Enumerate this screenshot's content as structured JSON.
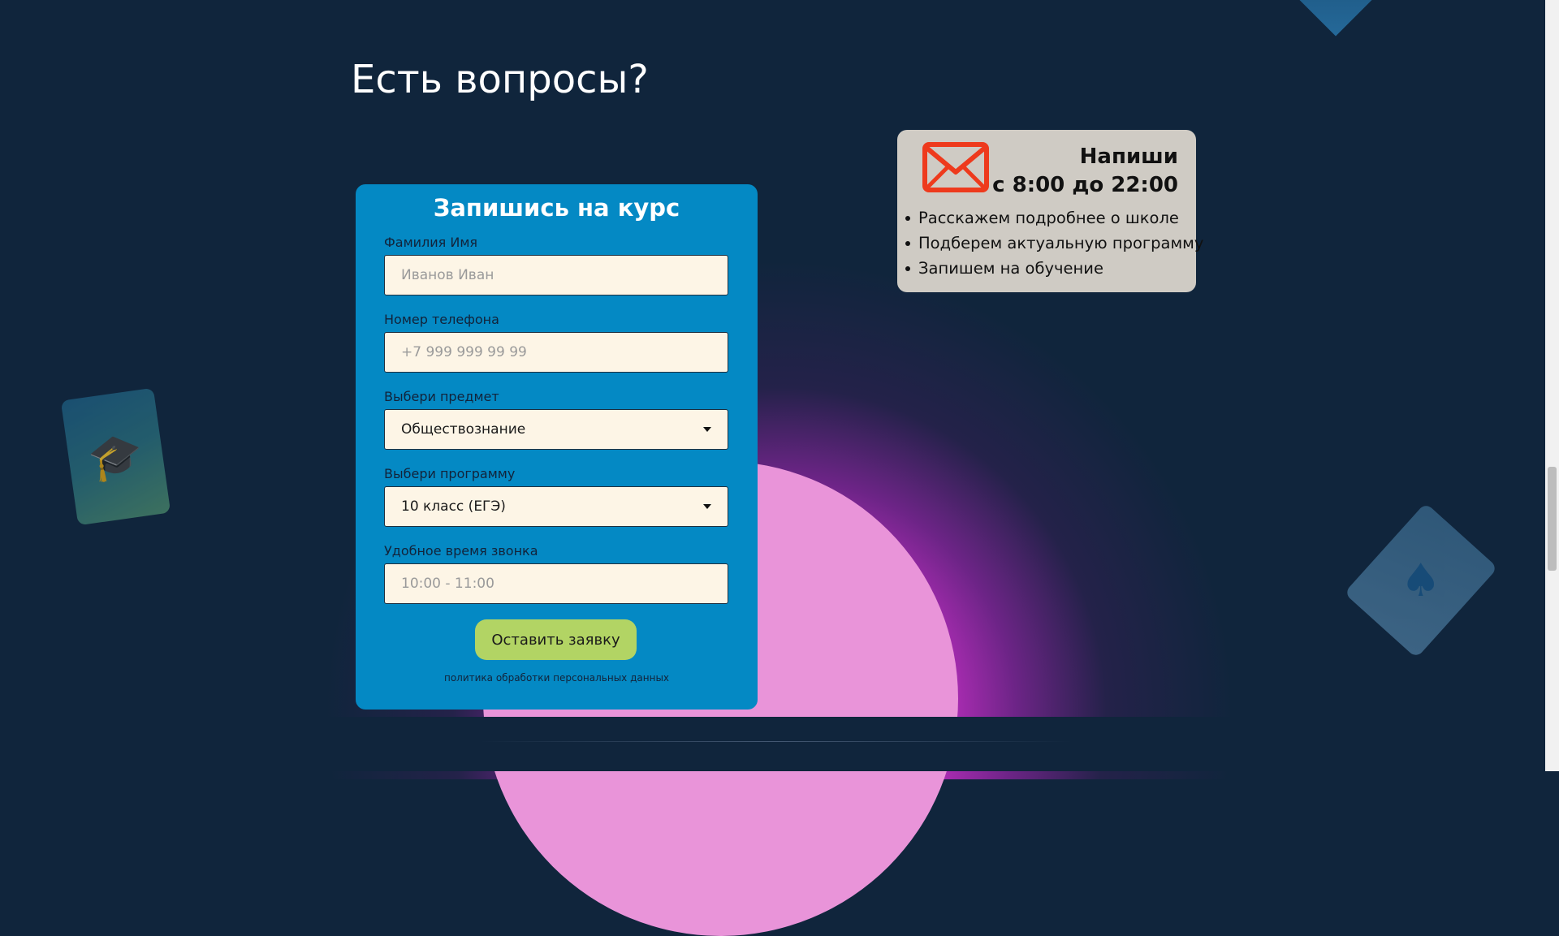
{
  "section": {
    "title": "Есть вопросы?"
  },
  "contact": {
    "heading_line1": "Напиши",
    "heading_line2": "с 8:00 до 22:00",
    "items": [
      "Расскажем подробнее о школе",
      "Подберем актуальную программу",
      "Запишем на обучение"
    ],
    "icon": "mail-icon",
    "icon_color": "#ee3a1d"
  },
  "form": {
    "title": "Запишись на курс",
    "name_label": "Фамилия Имя",
    "name_placeholder": "Иванов Иван",
    "phone_label": "Номер телефона",
    "phone_placeholder": "+7 999 999 99 99",
    "subject_label": "Выбери предмет",
    "subject_value": "Обществознание",
    "program_label": "Выбери программу",
    "program_value": "10 класс (ЕГЭ)",
    "time_label": "Удобное время звонка",
    "time_placeholder": "10:00 - 11:00",
    "submit_label": "Оставить заявку",
    "policy_link": "политика обработки персональных данных"
  },
  "colors": {
    "background": "#10253c",
    "form_card": "#0489c4",
    "contact_card": "#cfcbc4",
    "submit_button": "#b2d464",
    "input_background": "#fdf5e6",
    "glow": "#e23cdc",
    "circle": "#e994d9"
  },
  "decor": {
    "card_left_icon": "graduation-cap-icon",
    "card_right_icon": "spade-card-icon",
    "top_right_shape": "diamond-shape"
  }
}
